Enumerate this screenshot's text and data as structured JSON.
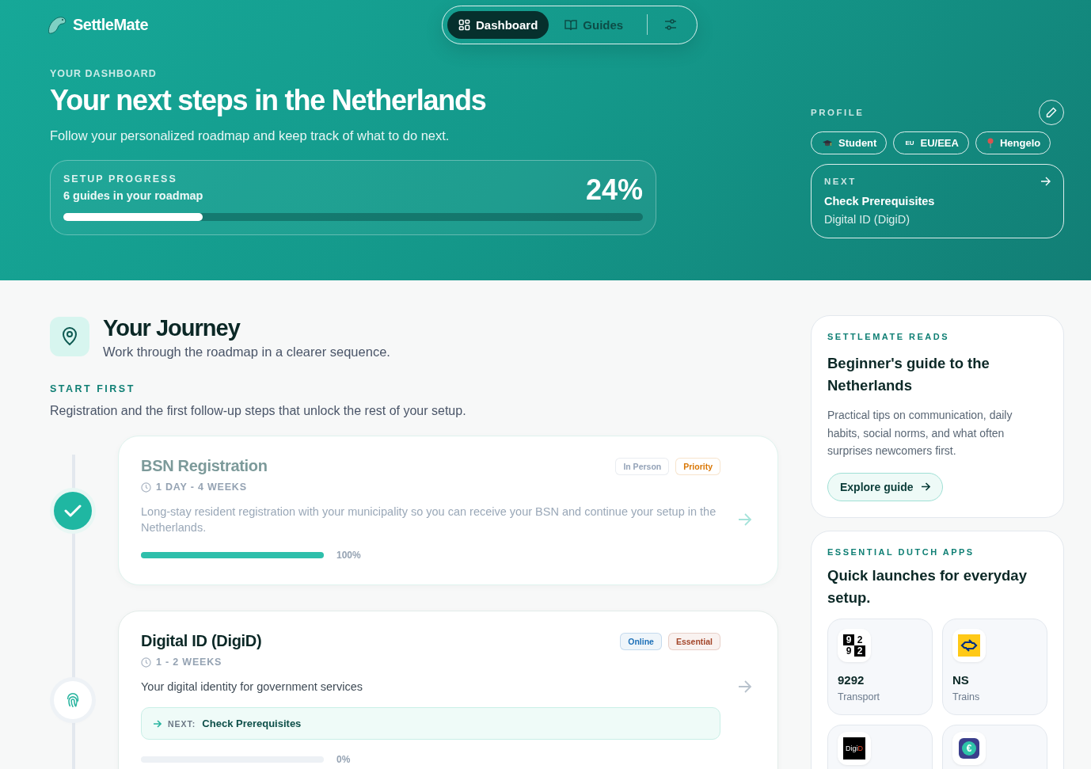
{
  "brand": {
    "name": "SettleMate"
  },
  "nav": {
    "tabs": [
      {
        "label": "Dashboard",
        "kind": "grid",
        "selected": true
      },
      {
        "label": "Guides",
        "kind": "book",
        "selected": false
      }
    ]
  },
  "hero": {
    "eyebrow": "YOUR DASHBOARD",
    "title": "Your next steps in the Netherlands",
    "subtitle": "Follow your personalized roadmap and keep track of what to do next.",
    "progress": {
      "label": "SETUP PROGRESS",
      "caption": "6 guides in your roadmap",
      "percent": "24%",
      "level": 0.24
    }
  },
  "profile": {
    "label": "PROFILE",
    "chips": [
      {
        "kind": "cap",
        "label": "Student"
      },
      {
        "kind": "eu",
        "label": "EU/EEA",
        "icon_text": "EU"
      },
      {
        "kind": "pin",
        "label": "Hengelo"
      }
    ],
    "next": {
      "label": "NEXT",
      "title": "Check Prerequisites",
      "subtitle": "Digital ID (DigiD)"
    }
  },
  "journey": {
    "title": "Your Journey",
    "subtitle": "Work through the roadmap in a clearer sequence.",
    "section_label": "START FIRST",
    "section_text": "Registration and the first follow-up steps that unlock the rest of your setup.",
    "steps": [
      {
        "title": "BSN Registration",
        "completed": true,
        "duration": "1 DAY - 4 WEEKS",
        "description": "Long-stay resident registration with your municipality so you can receive your BSN and continue your setup in the Netherlands.",
        "tags": [
          {
            "label": "In Person",
            "color": "#94a3b8"
          },
          {
            "label": "Priority",
            "color": "#d97706"
          }
        ],
        "level": 1.0,
        "percent": "100%"
      },
      {
        "title": "Digital ID (DigiD)",
        "completed": false,
        "duration": "1 - 2 WEEKS",
        "description": "Your digital identity for government services",
        "tags": [
          {
            "label": "Online",
            "color": "#1d70b8"
          },
          {
            "label": "Essential",
            "color": "#a3462a"
          }
        ],
        "next_label": "NEXT:",
        "next_title": "Check Prerequisites",
        "level": 0.0,
        "percent": "0%"
      }
    ]
  },
  "reads": {
    "label": "SETTLEMATE READS",
    "title": "Beginner's guide to the Netherlands",
    "text": "Practical tips on communication, daily habits, social norms, and what often surprises newcomers first.",
    "button": "Explore guide"
  },
  "apps": {
    "label": "ESSENTIAL DUTCH APPS",
    "title": "Quick launches for everyday setup.",
    "items": [
      {
        "kind": "grid",
        "logo_text": [
          "9",
          "2",
          "9",
          "2"
        ],
        "name": "9292",
        "category": "Transport"
      },
      {
        "kind": "ns",
        "name": "NS",
        "category": "Trains"
      },
      {
        "kind": "digid",
        "logo_text": [
          "Digi",
          "D"
        ]
      },
      {
        "kind": "euro",
        "logo_text": [
          "€"
        ]
      }
    ]
  }
}
